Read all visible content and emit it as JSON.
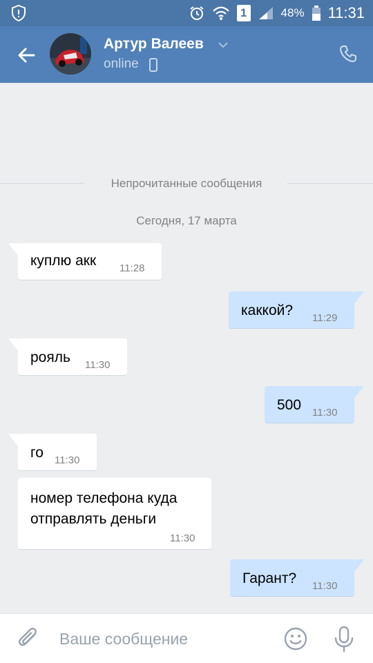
{
  "status_bar": {
    "battery": "48%",
    "time": "11:31",
    "sim_slot": "1",
    "icons": [
      "shield-icon",
      "alarm-icon",
      "wifi-icon",
      "sim-icon",
      "signal-icon",
      "battery-icon"
    ]
  },
  "header": {
    "name": "Артур Валеев",
    "status": "online",
    "icons": [
      "back-arrow-icon",
      "chevron-down-icon",
      "mobile-icon",
      "phone-icon"
    ]
  },
  "chat": {
    "unread_label": "Непрочитанные сообщения",
    "date_label": "Сегодня, 17 марта",
    "messages": [
      {
        "direction": "in",
        "lines": [
          "куплю акк"
        ],
        "time": "11:28"
      },
      {
        "direction": "out",
        "lines": [
          "каккой?"
        ],
        "time": "11:29"
      },
      {
        "direction": "in",
        "lines": [
          "рояль"
        ],
        "time": "11:30"
      },
      {
        "direction": "out",
        "lines": [
          "500"
        ],
        "time": "11:30"
      },
      {
        "direction": "in",
        "lines": [
          "го"
        ],
        "time": "11:30"
      },
      {
        "direction": "in",
        "lines": [
          "номер телефона куда",
          "отправлять деньги"
        ],
        "time": "11:30"
      },
      {
        "direction": "out",
        "lines": [
          "Гарант?"
        ],
        "time": "11:30"
      }
    ]
  },
  "input_bar": {
    "placeholder": "Ваше сообщение",
    "icons": [
      "paperclip-icon",
      "emoji-icon",
      "microphone-icon"
    ]
  },
  "colors": {
    "header": "#5181b8",
    "status_bar": "#4a76a8",
    "background": "#edeef0",
    "incoming_bubble": "#ffffff",
    "outgoing_bubble": "#cce4ff",
    "meta_text": "#828282"
  }
}
